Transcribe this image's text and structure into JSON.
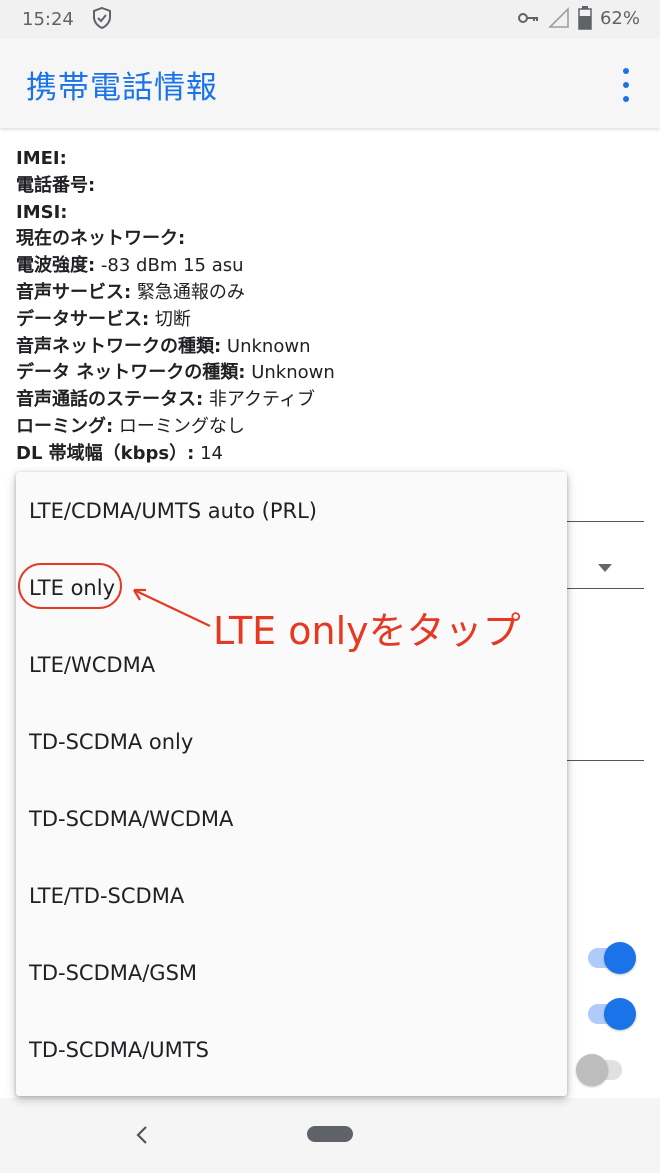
{
  "status_bar": {
    "time": "15:24",
    "battery_percent": "62%",
    "icons": [
      "shield-check-icon",
      "vpn-key-icon",
      "cellular-signal-icon",
      "battery-icon"
    ]
  },
  "app_bar": {
    "title": "携帯電話情報",
    "menu_icon": "more-vert-icon"
  },
  "info": [
    {
      "key": "IMEI:",
      "value": ""
    },
    {
      "key": "電話番号:",
      "value": ""
    },
    {
      "key": "IMSI:",
      "value": ""
    },
    {
      "key": "現在のネットワーク:",
      "value": ""
    },
    {
      "key": "電波強度:",
      "value": " -83 dBm   15 asu"
    },
    {
      "key": "音声サービス:",
      "value": " 緊急通報のみ"
    },
    {
      "key": "データサービス:",
      "value": " 切断"
    },
    {
      "key": "音声ネットワークの種類:",
      "value": " Unknown"
    },
    {
      "key": "データ ネットワークの種類:",
      "value": " Unknown"
    },
    {
      "key": "音声通話のステータス:",
      "value": " 非アクティブ"
    },
    {
      "key": "ローミング:",
      "value": " ローミングなし"
    },
    {
      "key": "DL 帯域幅（kbps）:",
      "value": " 14"
    }
  ],
  "dropdown": {
    "options": [
      "LTE/CDMA/UMTS auto (PRL)",
      "LTE only",
      "LTE/WCDMA",
      "TD-SCDMA only",
      "TD-SCDMA/WCDMA",
      "LTE/TD-SCDMA",
      "TD-SCDMA/GSM",
      "TD-SCDMA/UMTS"
    ]
  },
  "annotation": {
    "text": "LTE onlyをタップ",
    "color": "#e53922"
  },
  "toggles": [
    {
      "state": "on"
    },
    {
      "state": "on"
    },
    {
      "state": "off"
    }
  ],
  "colors": {
    "accent": "#1a73e8",
    "annotation": "#e53922"
  }
}
